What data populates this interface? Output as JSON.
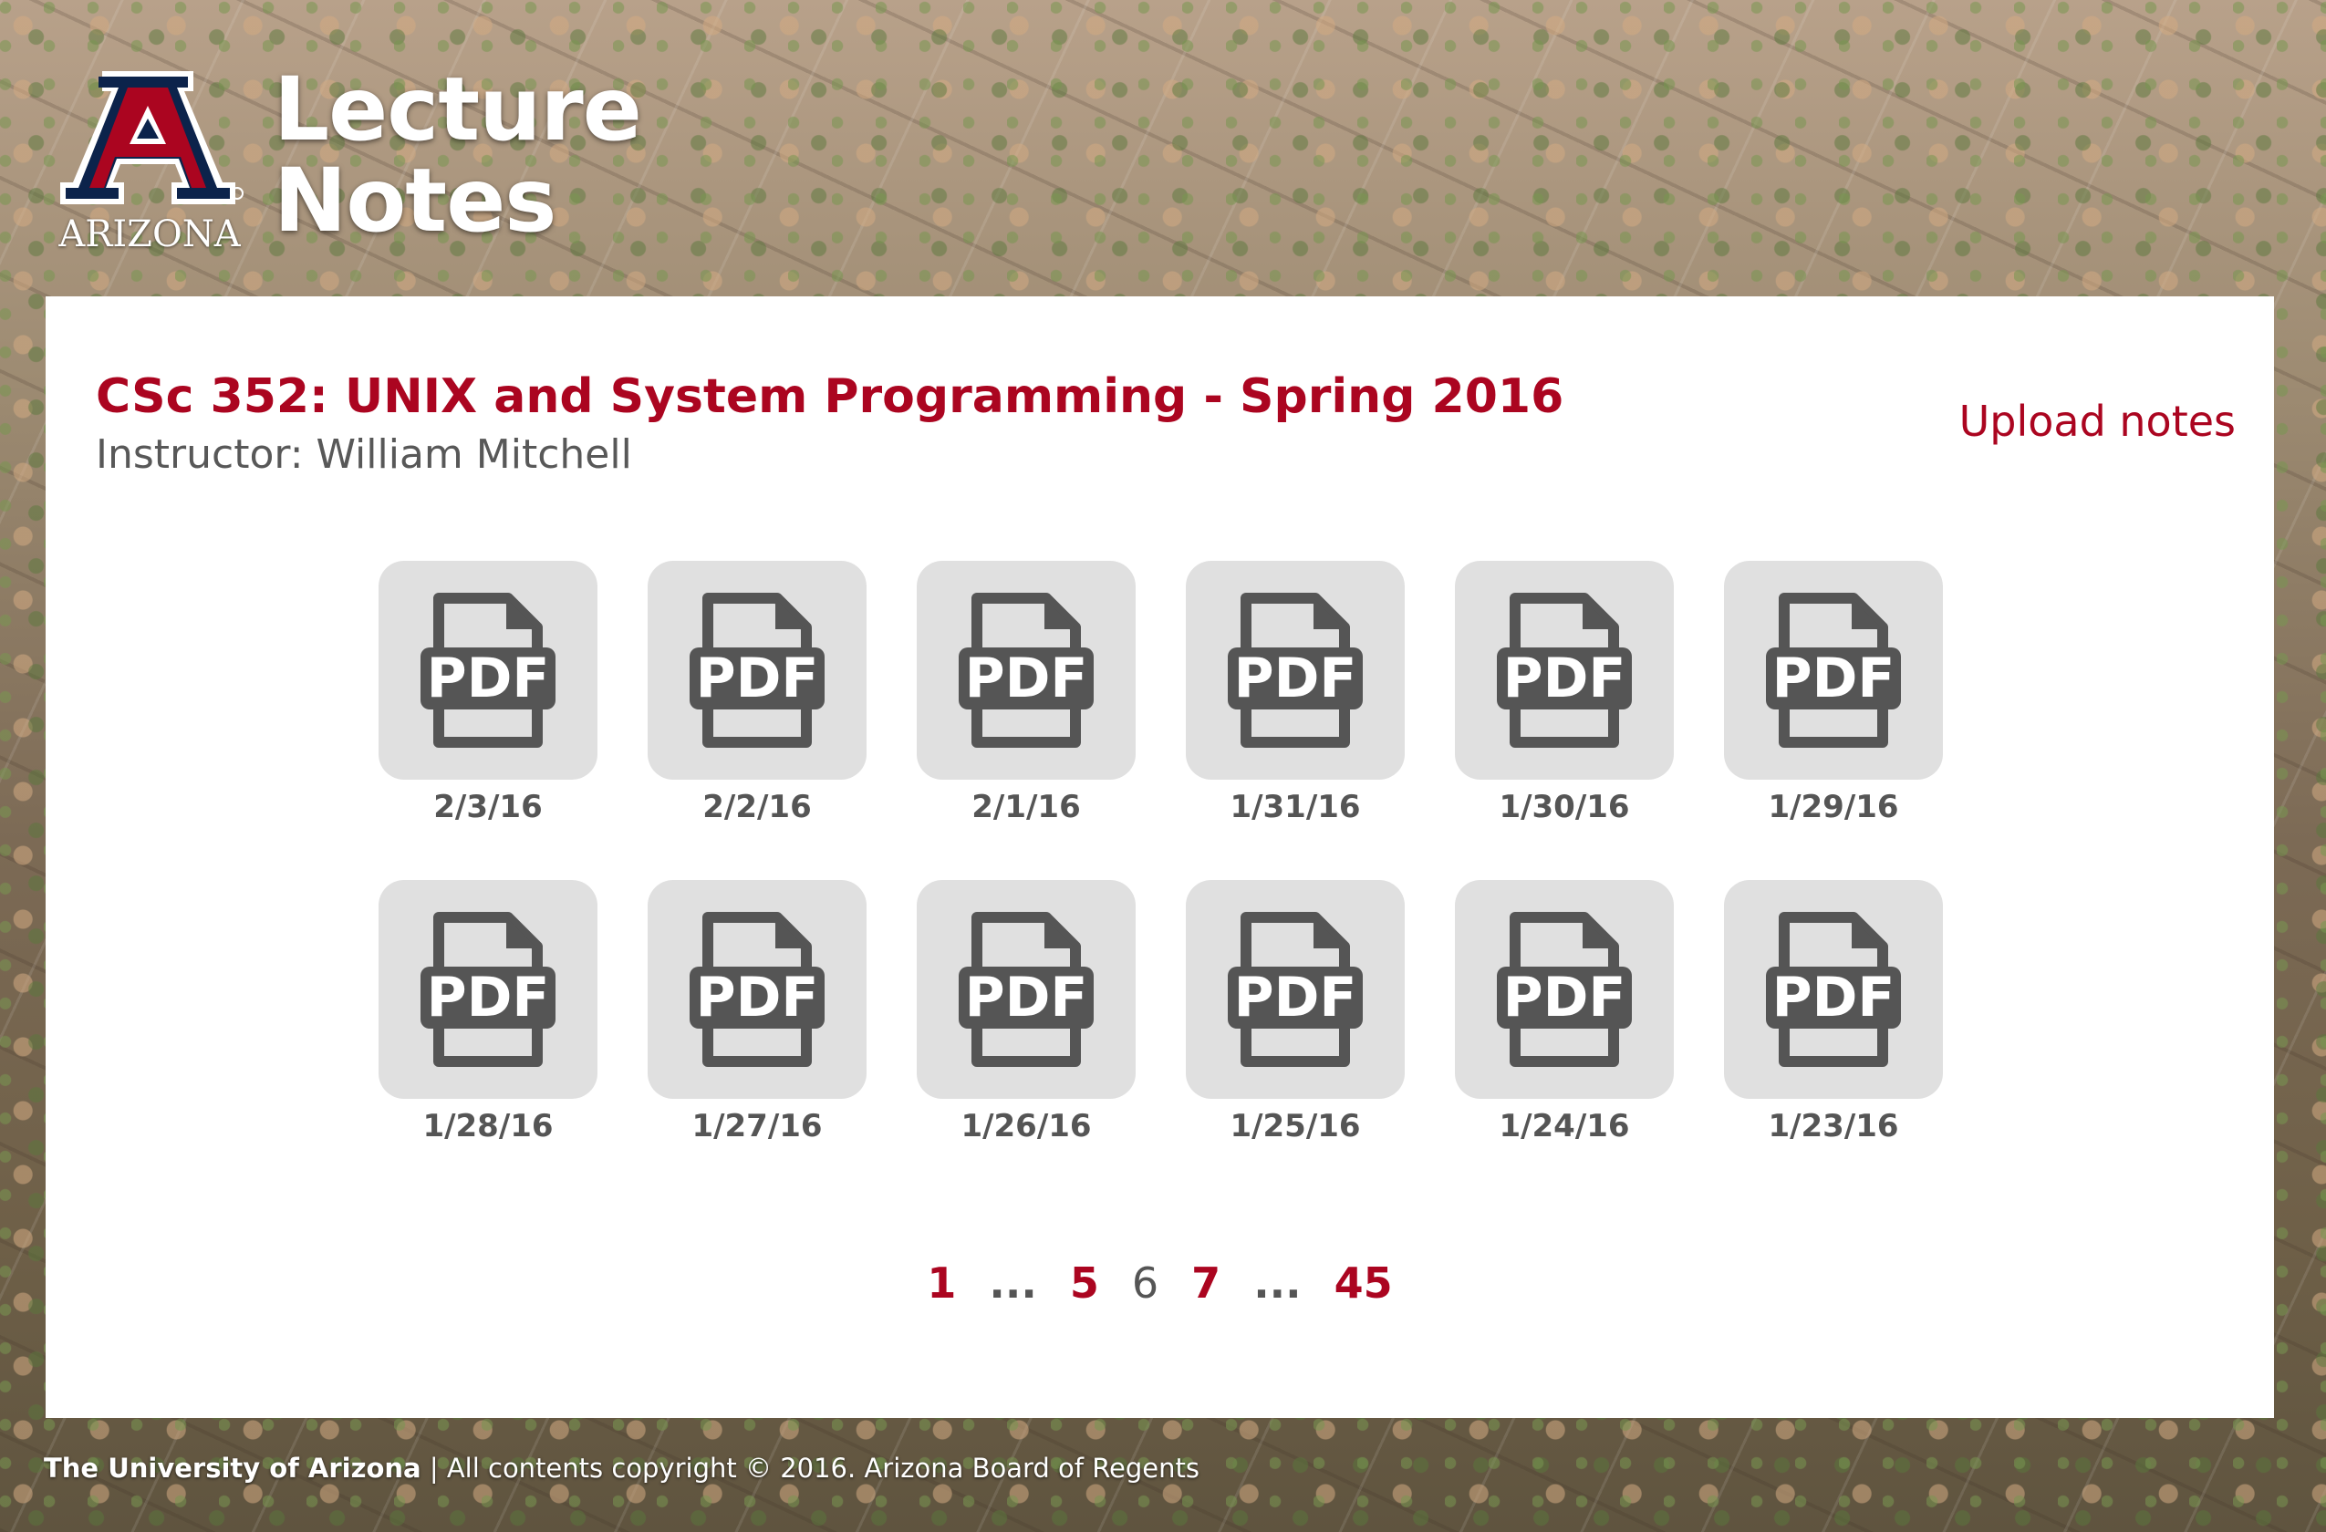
{
  "brand": {
    "logo_icon": "university-a-logo-icon",
    "logo_word": "ARIZONA",
    "title_line1": "Lecture",
    "title_line2": "Notes"
  },
  "course": {
    "title": "CSc 352: UNIX and System Programming - Spring 2016",
    "instructor": "Instructor: William Mitchell",
    "upload_label": "Upload notes"
  },
  "notes": [
    {
      "icon": "pdf-icon",
      "date": "2/3/16"
    },
    {
      "icon": "pdf-icon",
      "date": "2/2/16"
    },
    {
      "icon": "pdf-icon",
      "date": "2/1/16"
    },
    {
      "icon": "pdf-icon",
      "date": "1/31/16"
    },
    {
      "icon": "pdf-icon",
      "date": "1/30/16"
    },
    {
      "icon": "pdf-icon",
      "date": "1/29/16"
    },
    {
      "icon": "pdf-icon",
      "date": "1/28/16"
    },
    {
      "icon": "pdf-icon",
      "date": "1/27/16"
    },
    {
      "icon": "pdf-icon",
      "date": "1/26/16"
    },
    {
      "icon": "pdf-icon",
      "date": "1/25/16"
    },
    {
      "icon": "pdf-icon",
      "date": "1/24/16"
    },
    {
      "icon": "pdf-icon",
      "date": "1/23/16"
    }
  ],
  "pdf_label": "PDF",
  "pagination": {
    "first": "1",
    "ellipsis": "...",
    "prev": "5",
    "current": "6",
    "next": "7",
    "last": "45"
  },
  "footer": {
    "org": "The University of Arizona",
    "separator": "|",
    "copyright": "All contents copyright © 2016. Arizona Board of Regents"
  },
  "colors": {
    "accent": "#ab0520",
    "navy": "#0c234b",
    "tile_bg": "#e0e0e0",
    "icon_gray": "#555555"
  }
}
